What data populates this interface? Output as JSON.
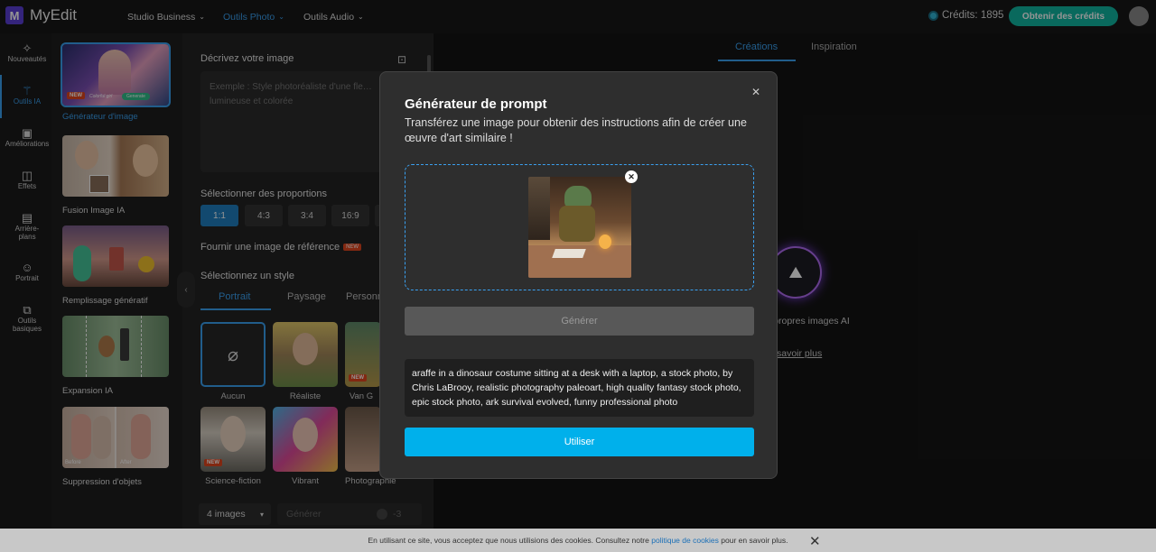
{
  "app": {
    "logo_letter": "M",
    "name": "MyEdit"
  },
  "nav": [
    {
      "label": "Studio Business"
    },
    {
      "label": "Outils Photo"
    },
    {
      "label": "Outils Audio"
    }
  ],
  "credits": {
    "label": "Crédits: 1895",
    "button": "Obtenir des crédits"
  },
  "rail": [
    {
      "label": "Nouveautés",
      "icon": "sparkle-icon"
    },
    {
      "label": "Outils IA",
      "icon": "magic-wand-icon"
    },
    {
      "label": "Améliorations",
      "icon": "image-enhance-icon"
    },
    {
      "label": "Effets",
      "icon": "effects-icon"
    },
    {
      "label": "Arrière-plans",
      "icon": "background-icon"
    },
    {
      "label": "Portrait",
      "icon": "portrait-icon"
    },
    {
      "label": "Outils basiques",
      "icon": "basic-tools-icon"
    }
  ],
  "tools": [
    {
      "label": "Générateur d'image",
      "badge": "NEW",
      "overlay": "Colorful girl",
      "overlay_btn": "Generate"
    },
    {
      "label": "Fusion Image IA"
    },
    {
      "label": "Remplissage génératif"
    },
    {
      "label": "Expansion IA"
    },
    {
      "label": "Suppression d'objets",
      "before": "Before",
      "after": "After"
    }
  ],
  "form": {
    "describe_title": "Décrivez votre image",
    "describe_placeholder": "Exemple : Style photoréaliste d'une fle… lumineuse et colorée",
    "ratio_title": "Sélectionner des proportions",
    "ratios": [
      "1:1",
      "4:3",
      "3:4",
      "16:9"
    ],
    "reference_title": "Fournir une image de référence",
    "reference_badge": "NEW",
    "style_title": "Sélectionnez un style",
    "style_tabs": [
      "Portrait",
      "Paysage",
      "Personn"
    ],
    "styles": [
      {
        "label": "Aucun"
      },
      {
        "label": "Réaliste"
      },
      {
        "label": "Van G",
        "badge": "NEW"
      },
      {
        "label": "Science-fiction",
        "badge": "NEW"
      },
      {
        "label": "Vibrant"
      },
      {
        "label": "Photographie"
      }
    ],
    "images_count": "4 images",
    "generate_label": "Générer",
    "generate_cost": "-3"
  },
  "right": {
    "tabs": [
      "Créations",
      "Inspiration"
    ],
    "empty_text": "s propres images AI",
    "learn_more": "savoir plus"
  },
  "modal": {
    "title": "Générateur de prompt",
    "subtitle": "Transférez une image pour obtenir des instructions afin de créer une œuvre d'art similaire !",
    "generate_button": "Générer",
    "prompt_result": "araffe in a dinosaur costume sitting at a desk with a laptop, a stock photo, by Chris LaBrooy, realistic photography paleoart, high quality fantasy stock photo, epic stock photo, ark survival evolved, funny professional photo",
    "use_button": "Utiliser"
  },
  "cookie": {
    "text_before": "En utilisant ce site, vous acceptez que nous utilisions des cookies. Consultez notre",
    "link": "politique de cookies",
    "text_after": "pour en savoir plus."
  },
  "colors": {
    "accent": "#3aa0f0",
    "primary_button": "#00b0eb",
    "credits_button": "#10b5a0",
    "new_badge": "#e0461e"
  }
}
